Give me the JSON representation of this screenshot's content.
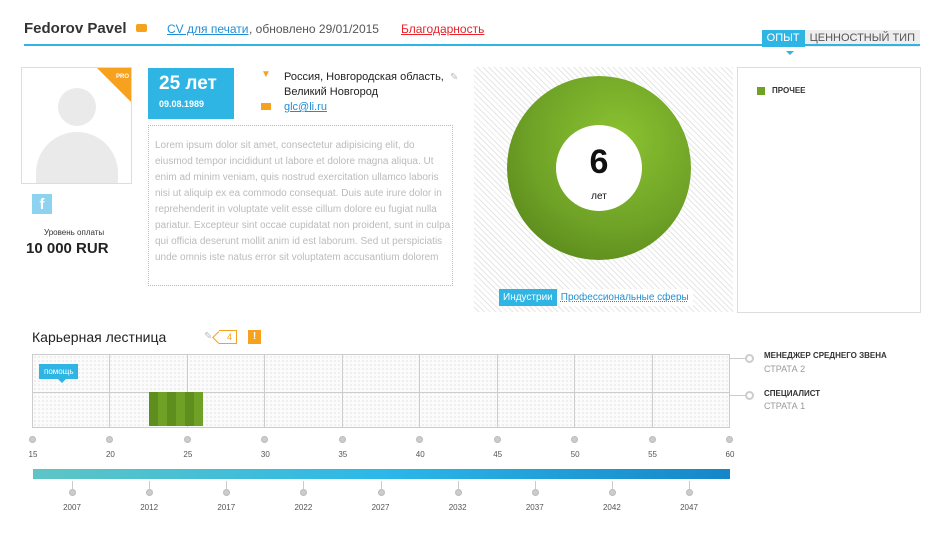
{
  "header": {
    "name": "Fedorov Pavel",
    "cv_link": "CV для печати",
    "updated": ", обновлено 29/01/2015",
    "thanks_link": "Благодарность"
  },
  "tabs": [
    {
      "label": "ОПЫТ",
      "active": true
    },
    {
      "label": "ЦЕННОСТНЫЙ ТИП",
      "active": false
    }
  ],
  "profile": {
    "pro_badge": "PRO",
    "facebook_glyph": "f",
    "pay_label": "Уровень оплаты",
    "pay_value": "10 000 RUR",
    "age": "25 лет",
    "birth_date": "09.08.1989",
    "location": "Россия, Новгородская область, Великий Новгород",
    "email": "glc@li.ru",
    "about": "Lorem ipsum dolor sit amet, consectetur adipisicing elit, do eiusmod tempor incididunt ut labore et dolore magna aliqua. Ut enim ad minim veniam, quis nostrud exercitation ullamco laboris nisi ut aliquip ex ea commodo consequat. Duis aute irure dolor in reprehenderit in voluptate velit esse cillum dolore eu fugiat nulla pariatur. Excepteur sint occae cupidatat non proident, sunt in culpa qui officia deserunt mollit anim id est laborum. Sed ut perspiciatis unde omnis iste natus error sit voluptatem accusantium dolorem"
  },
  "experience": {
    "total_value": "6",
    "total_unit": "лет",
    "tabs": [
      {
        "label": "Индустрии",
        "active": true
      },
      {
        "label": "Профессиональные сферы",
        "active": false
      }
    ],
    "legend": [
      {
        "label": "ПРОЧЕЕ",
        "color": "#6ea126"
      }
    ]
  },
  "career": {
    "title": "Карьерная лестница",
    "count": "4",
    "warning_glyph": "!",
    "help_label": "помощь",
    "levels": [
      {
        "title": "МЕНЕДЖЕР СРЕДНЕГО ЗВЕНА",
        "subtitle": "СТРАТА 2"
      },
      {
        "title": "СПЕЦИАЛИСТ",
        "subtitle": "СТРАТА 1"
      }
    ],
    "age_ticks": [
      "15",
      "20",
      "25",
      "30",
      "35",
      "40",
      "45",
      "50",
      "55",
      "60"
    ],
    "year_ticks": [
      "2007",
      "2012",
      "2017",
      "2022",
      "2027",
      "2032",
      "2037",
      "2042",
      "2047"
    ],
    "position": {
      "level": "СПЕЦИАЛИСТ",
      "age_from": 22.5,
      "age_to": 26
    }
  },
  "colors": {
    "accent": "#2fb5e4",
    "highlight": "#f6a21e",
    "chart_green": "#6ea126",
    "link": "#1e8fd6",
    "danger": "#e8232a"
  },
  "icons": [
    "pro-badge-icon",
    "location-pin-icon",
    "mail-icon",
    "edit-pencil-icon",
    "facebook-icon",
    "warning-icon"
  ]
}
